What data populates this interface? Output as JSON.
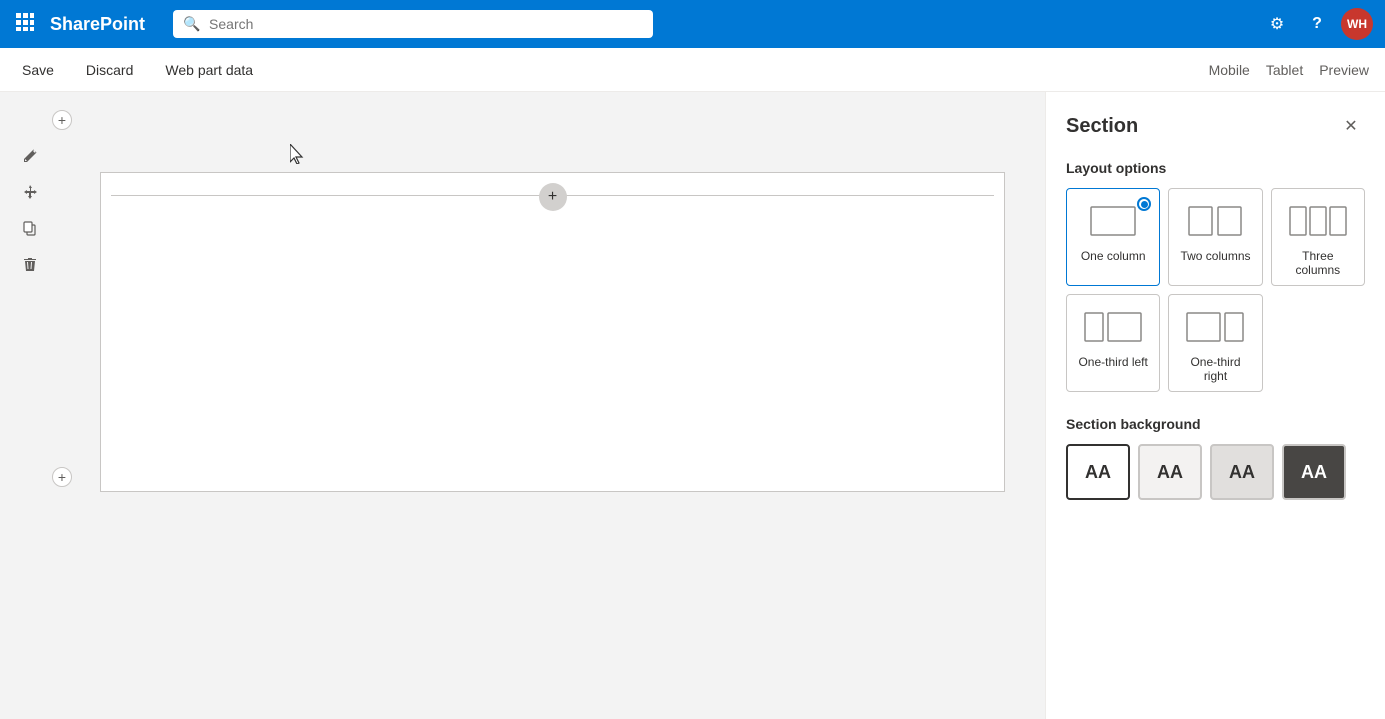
{
  "topbar": {
    "app_name": "SharePoint",
    "search_placeholder": "Search",
    "settings_icon": "⚙",
    "help_icon": "?",
    "avatar_initials": "WH"
  },
  "actionbar": {
    "save_label": "Save",
    "discard_label": "Discard",
    "webpart_data_label": "Web part data",
    "mobile_label": "Mobile",
    "tablet_label": "Tablet",
    "preview_label": "Preview"
  },
  "panel": {
    "title": "Section",
    "layout_options_label": "Layout options",
    "section_background_label": "Section background",
    "layouts": [
      {
        "id": "one-column",
        "label": "One column",
        "selected": true
      },
      {
        "id": "two-columns",
        "label": "Two columns",
        "selected": false
      },
      {
        "id": "three-columns",
        "label": "Three columns",
        "selected": false
      },
      {
        "id": "one-third-left",
        "label": "One-third left",
        "selected": false
      },
      {
        "id": "one-third-right",
        "label": "One-third right",
        "selected": false
      }
    ],
    "backgrounds": [
      {
        "id": "white",
        "label": "AA",
        "selected": true
      },
      {
        "id": "light",
        "label": "AA",
        "selected": false
      },
      {
        "id": "neutral",
        "label": "AA",
        "selected": false
      },
      {
        "id": "dark",
        "label": "AA",
        "selected": false
      }
    ]
  },
  "toolbar": {
    "edit_icon": "✏",
    "move_icon": "✥",
    "copy_icon": "⧉",
    "delete_icon": "🗑"
  }
}
